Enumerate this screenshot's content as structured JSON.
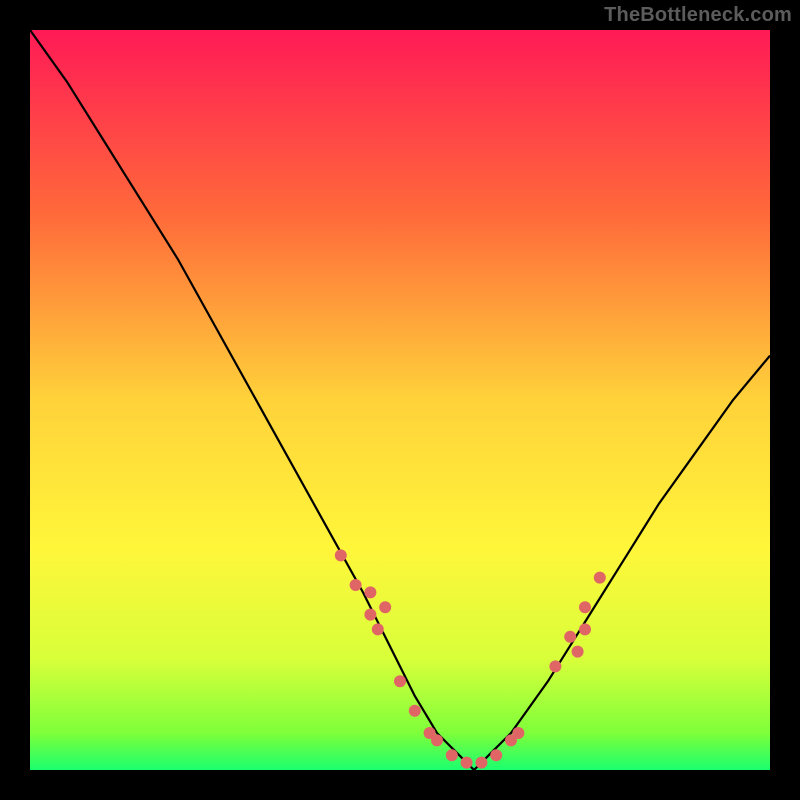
{
  "watermark": "TheBottleneck.com",
  "chart_data": {
    "type": "line",
    "title": "",
    "xlabel": "",
    "ylabel": "",
    "xlim": [
      0,
      100
    ],
    "ylim": [
      0,
      100
    ],
    "grid": false,
    "legend": false,
    "background": "rainbow-vertical-gradient (red top → green bottom)",
    "frame": "black",
    "series": [
      {
        "name": "bottleneck-curve",
        "color": "#000000",
        "x": [
          0,
          5,
          10,
          15,
          20,
          25,
          30,
          35,
          40,
          45,
          50,
          52,
          55,
          58,
          60,
          62,
          65,
          70,
          75,
          80,
          85,
          90,
          95,
          100
        ],
        "y": [
          100,
          93,
          85,
          77,
          69,
          60,
          51,
          42,
          33,
          24,
          14,
          10,
          5,
          2,
          0,
          2,
          5,
          12,
          20,
          28,
          36,
          43,
          50,
          56
        ]
      }
    ],
    "curve_points": [
      {
        "x": 42,
        "y": 29
      },
      {
        "x": 44,
        "y": 25
      },
      {
        "x": 46,
        "y": 21
      },
      {
        "x": 47,
        "y": 19
      },
      {
        "x": 50,
        "y": 12
      },
      {
        "x": 52,
        "y": 8
      },
      {
        "x": 54,
        "y": 5
      },
      {
        "x": 55,
        "y": 4
      },
      {
        "x": 57,
        "y": 2
      },
      {
        "x": 59,
        "y": 1
      },
      {
        "x": 61,
        "y": 1
      },
      {
        "x": 63,
        "y": 2
      },
      {
        "x": 65,
        "y": 4
      },
      {
        "x": 66,
        "y": 5
      },
      {
        "x": 71,
        "y": 14
      },
      {
        "x": 73,
        "y": 18
      },
      {
        "x": 75,
        "y": 22
      },
      {
        "x": 77,
        "y": 26
      },
      {
        "x": 46,
        "y": 24
      },
      {
        "x": 48,
        "y": 22
      },
      {
        "x": 75,
        "y": 19
      },
      {
        "x": 74,
        "y": 16
      }
    ],
    "point_color": "#e06666",
    "gradient_stops": [
      {
        "offset": 0.0,
        "color": "#ff1a56"
      },
      {
        "offset": 0.25,
        "color": "#ff6a3a"
      },
      {
        "offset": 0.5,
        "color": "#ffd23a"
      },
      {
        "offset": 0.7,
        "color": "#fff63a"
      },
      {
        "offset": 0.85,
        "color": "#d8ff3a"
      },
      {
        "offset": 0.95,
        "color": "#7eff3a"
      },
      {
        "offset": 1.0,
        "color": "#1aff6e"
      }
    ]
  }
}
